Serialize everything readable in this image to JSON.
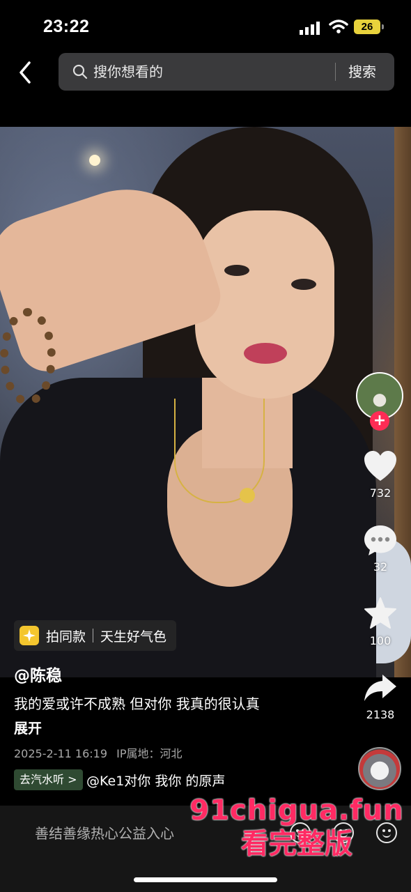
{
  "status_bar": {
    "time": "23:22",
    "battery": "26"
  },
  "search": {
    "placeholder": "搜你想看的",
    "button_label": "搜索"
  },
  "video": {
    "tag": {
      "left": "拍同款",
      "right": "天生好气色"
    },
    "author": "@陈稳",
    "caption": "我的爱或许不成熟 但对你 我真的很认真",
    "expand_label": "展开",
    "date": "2025-2-11 16:19",
    "ip_location": "IP属地：河北",
    "qishui_label": "去汽水听 >",
    "sound_title": "@Ke1对你 我你 的原声"
  },
  "actions": {
    "likes": "732",
    "comments": "32",
    "favorites": "100",
    "shares": "2138"
  },
  "bottom_bar": {
    "comment_hint": "善结善缘热心公益入心"
  },
  "watermark": {
    "line1": "91chigua.fun",
    "line2": "看完整版"
  },
  "icons": [
    "back-icon",
    "search-icon",
    "heart-icon",
    "comment-icon",
    "star-icon",
    "share-icon",
    "emoji-icon",
    "signal-icon",
    "wifi-icon"
  ],
  "colors": {
    "background": "#000000",
    "follow_red": "#fe2c55",
    "battery_yellow": "#e8d23c",
    "watermark_pink": "#ff2a63"
  }
}
